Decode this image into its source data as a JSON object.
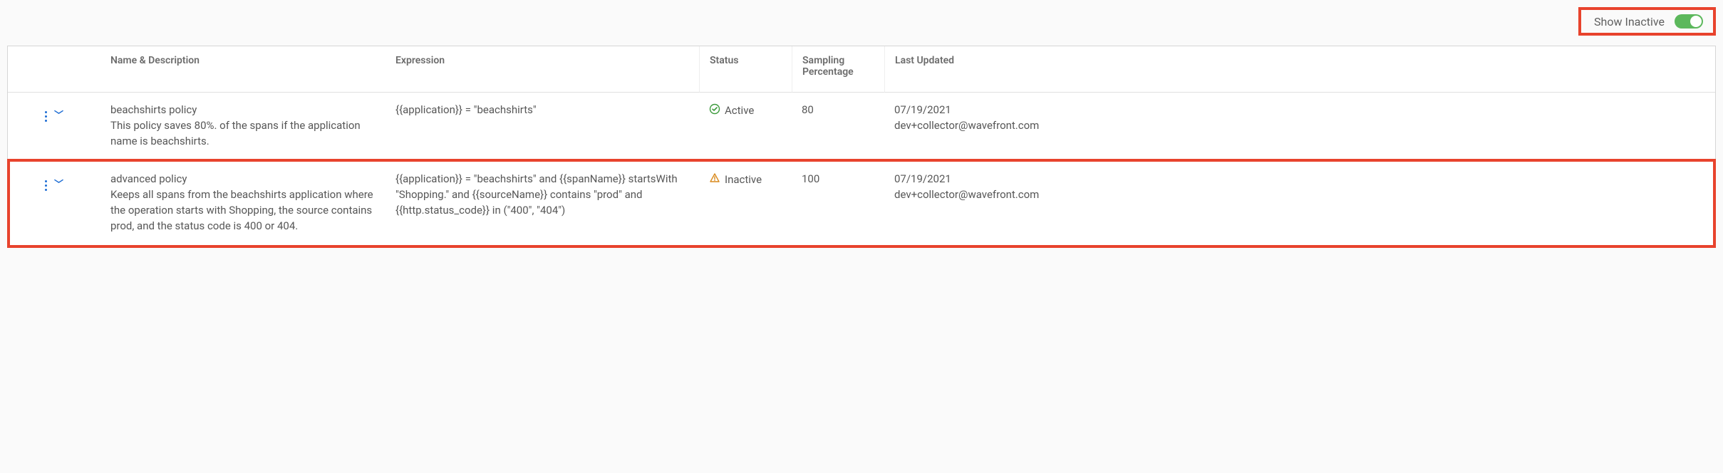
{
  "toolbar": {
    "show_inactive_label": "Show Inactive",
    "show_inactive_on": true
  },
  "columns": {
    "name": "Name & Description",
    "expression": "Expression",
    "status": "Status",
    "sampling": "Sampling\nPercentage",
    "updated": "Last Updated"
  },
  "rows": [
    {
      "name": "beachshirts policy",
      "description": "This policy saves 80%. of the spans if the application name is beachshirts.",
      "expression": "{{application}} = \"beachshirts\"",
      "status": "Active",
      "sampling": "80",
      "updated_date": "07/19/2021",
      "updated_by": "dev+collector@wavefront.com",
      "highlighted": false
    },
    {
      "name": "advanced policy",
      "description": "Keeps all spans from the beachshirts application where the operation starts with Shopping, the source contains prod, and the status code is 400 or 404.",
      "expression": "{{application}} = \"beachshirts\" and {{spanName}} startsWith \"Shopping.\" and {{sourceName}} contains \"prod\" and {{http.status_code}} in (\"400\", \"404\")",
      "status": "Inactive",
      "sampling": "100",
      "updated_date": "07/19/2021",
      "updated_by": "dev+collector@wavefront.com",
      "highlighted": true
    }
  ]
}
